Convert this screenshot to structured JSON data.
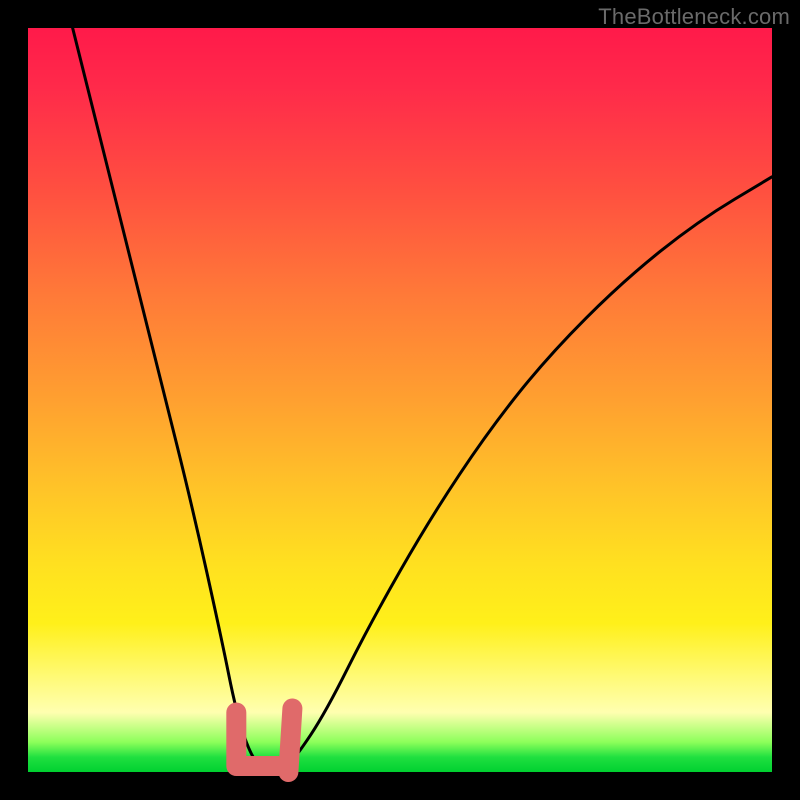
{
  "watermark": "TheBottleneck.com",
  "chart_data": {
    "type": "line",
    "title": "",
    "xlabel": "",
    "ylabel": "",
    "xlim": [
      0,
      100
    ],
    "ylim": [
      0,
      100
    ],
    "background_gradient": {
      "top": "#ff1a4a",
      "mid_upper": "#ff9a30",
      "mid_lower": "#fff020",
      "bottom": "#00d030"
    },
    "series": [
      {
        "name": "bottleneck-curve",
        "x": [
          6,
          10,
          14,
          18,
          22,
          26,
          28,
          30,
          32,
          34,
          36,
          40,
          46,
          54,
          62,
          70,
          80,
          90,
          100
        ],
        "values": [
          100,
          84,
          68,
          52,
          36,
          18,
          8,
          2,
          0,
          0,
          2,
          8,
          20,
          34,
          46,
          56,
          66,
          74,
          80
        ]
      }
    ],
    "annotations": [
      {
        "name": "highlight-valley",
        "type": "thick-stroke",
        "color": "#e86a6a",
        "x_range": [
          28,
          35
        ],
        "y_range": [
          0,
          8
        ]
      }
    ]
  }
}
